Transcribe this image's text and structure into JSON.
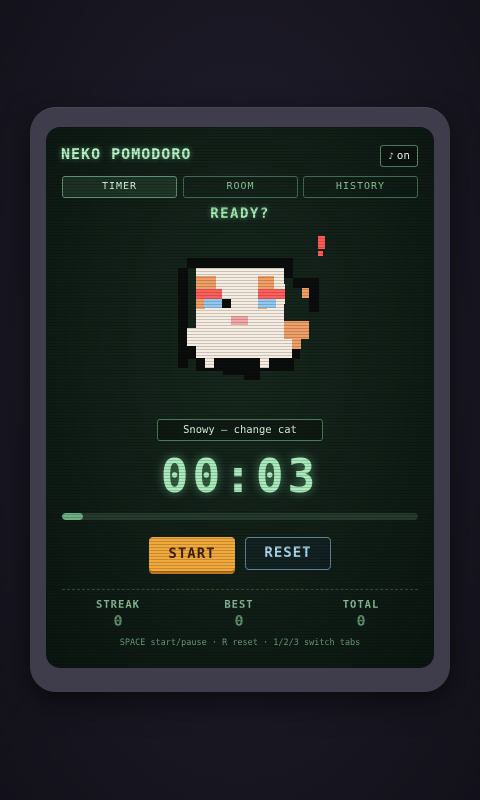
{
  "app": {
    "title": "NEKO POMODORO",
    "music_label": "on",
    "music_icon": "music-note-icon"
  },
  "tabs": [
    {
      "label": "TIMER",
      "active": true
    },
    {
      "label": "ROOM",
      "active": false
    },
    {
      "label": "HISTORY",
      "active": false
    }
  ],
  "status": "READY?",
  "alert_mark": "!",
  "cat": {
    "name_button": "Snowy — change cat"
  },
  "timer": {
    "display": "00:03",
    "progress_fraction": 0.06
  },
  "buttons": {
    "start": "START",
    "reset": "RESET"
  },
  "stats": [
    {
      "label": "STREAK",
      "value": "0"
    },
    {
      "label": "BEST",
      "value": "0"
    },
    {
      "label": "TOTAL",
      "value": "0"
    }
  ],
  "hint": "SPACE start/pause · R reset · 1/2/3 switch tabs",
  "colors": {
    "accent_green": "#a9ebbd",
    "start_orange": "#f2a93b",
    "reset_blue": "#a9d8f0",
    "alert_red": "#ff5a55"
  }
}
